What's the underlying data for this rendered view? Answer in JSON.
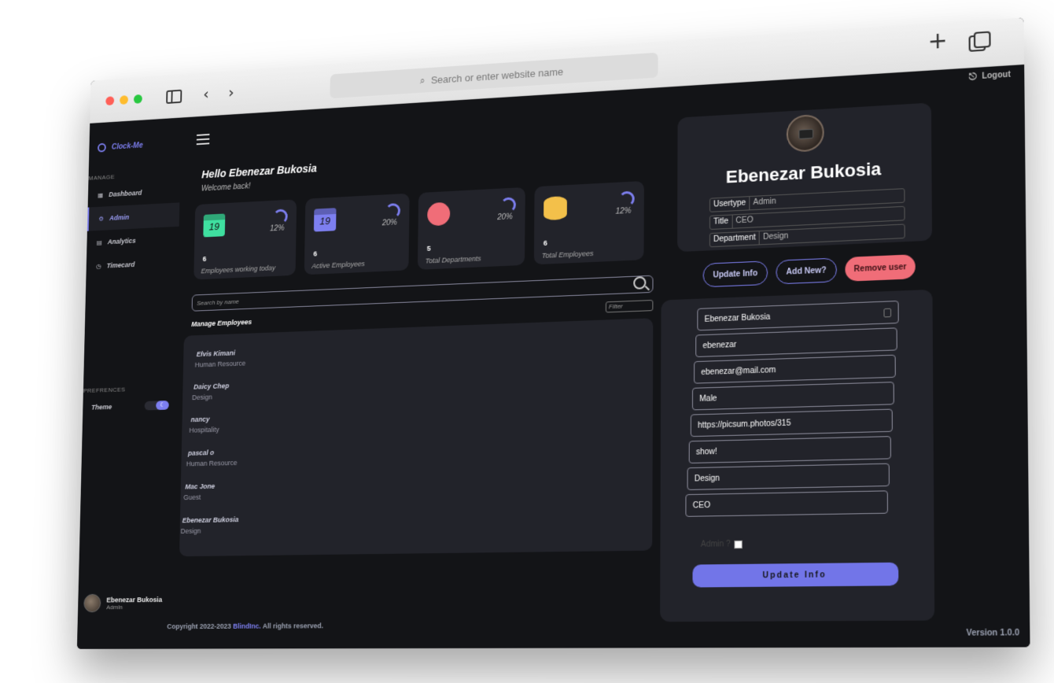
{
  "browser": {
    "address_placeholder": "Search or enter website name"
  },
  "app": {
    "logo": "Clock-Me",
    "logout": "Logout",
    "manage_label": "MANAGE",
    "preferences_label": "PREFRENCES",
    "nav": [
      {
        "label": "Dashboard",
        "icon": "grid-icon"
      },
      {
        "label": "Admin",
        "icon": "gear-icon",
        "active": true
      },
      {
        "label": "Analytics",
        "icon": "chart-icon"
      },
      {
        "label": "Timecard",
        "icon": "clock-icon"
      }
    ],
    "theme_label": "Theme",
    "user_footer": {
      "name": "Ebenezar Bukosia",
      "role": "Admin"
    },
    "copyright_prefix": "Copyright 2022-2023 ",
    "copyright_brand": "BlindInc.",
    "copyright_suffix": " All rights reserved.",
    "version": "Version 1.0.0"
  },
  "header": {
    "hello": "Hello Ebenezar Bukosia",
    "welcome": "Welcome back!"
  },
  "stats": [
    {
      "count": "6",
      "label": "Employees working today",
      "percent": "12%",
      "icon_text": "19",
      "color": "#3fe0a0"
    },
    {
      "count": "6",
      "label": "Active Employees",
      "percent": "20%",
      "icon_text": "19",
      "color": "#7d7ff0"
    },
    {
      "count": "5",
      "label": "Total Departments",
      "percent": "20%",
      "icon_text": "",
      "color": "#f06d78"
    },
    {
      "count": "6",
      "label": "Total Employees",
      "percent": "12%",
      "icon_text": "",
      "color": "#f3c04a"
    }
  ],
  "search": {
    "placeholder": "Search by name"
  },
  "manage": {
    "title": "Manage Employees",
    "filter_placeholder": "Filter"
  },
  "employees": [
    {
      "name": "Elvis Kimani",
      "dept": "Human Resource"
    },
    {
      "name": "Daicy Chep",
      "dept": "Design"
    },
    {
      "name": "nancy",
      "dept": "Hospitality"
    },
    {
      "name": "pascal o",
      "dept": "Human Resource"
    },
    {
      "name": "Mac Jone",
      "dept": "Guest"
    },
    {
      "name": "Ebenezar Bukosia",
      "dept": "Design"
    }
  ],
  "profile": {
    "name": "Ebenezar Bukosia",
    "rows": [
      {
        "key": "Usertype",
        "value": "Admin"
      },
      {
        "key": "Title",
        "value": "CEO"
      },
      {
        "key": "Department",
        "value": "Design"
      }
    ]
  },
  "actions": {
    "update_info": "Update Info",
    "add_new": "Add New?",
    "remove_user": "Remove user"
  },
  "form": {
    "fields": [
      "Ebenezar Bukosia",
      "ebenezar",
      "ebenezar@mail.com",
      "Male",
      "https://picsum.photos/315",
      "show!",
      "Design",
      "CEO"
    ],
    "admin_label": "Admin ?",
    "submit": "Update Info"
  }
}
